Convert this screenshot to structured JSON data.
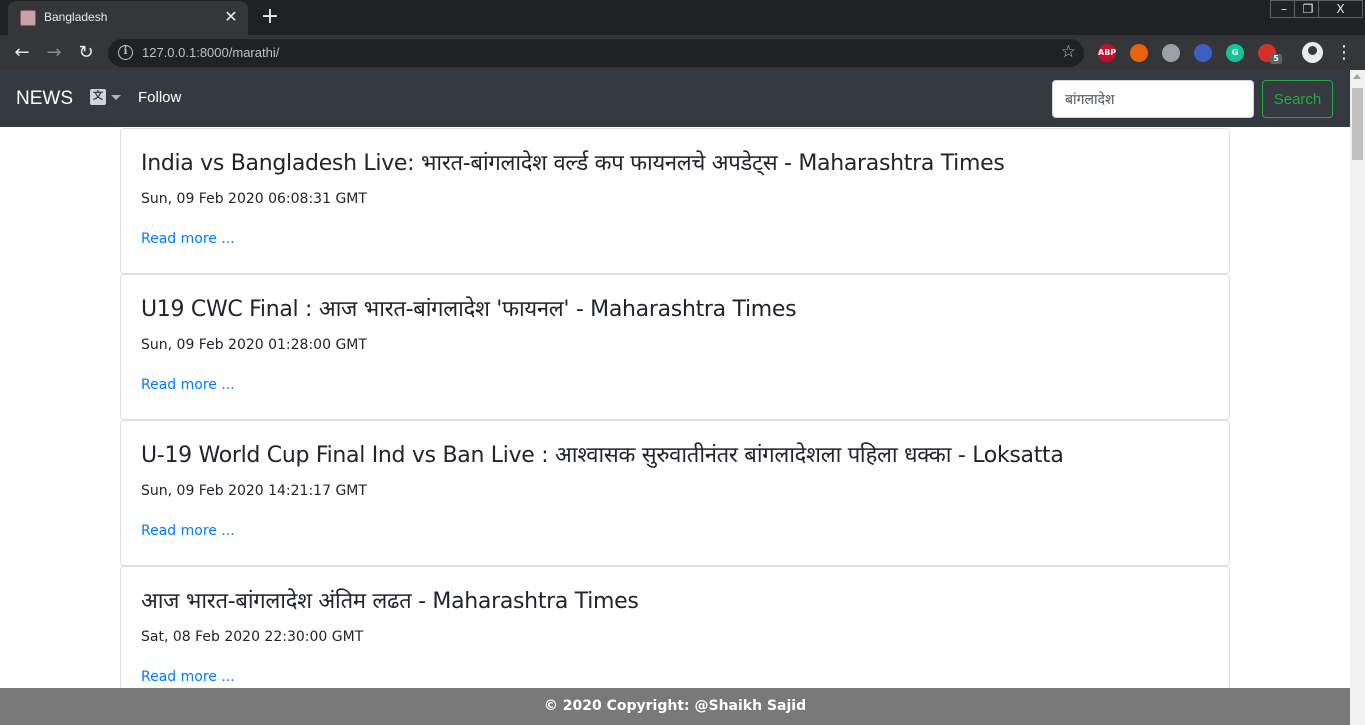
{
  "browser": {
    "tab_title": "Bangladesh",
    "tab_close": "✕",
    "new_tab": "+",
    "url": "127.0.0.1:8000/marathi/",
    "window_controls": {
      "minimize": "–",
      "restore": "❐",
      "close": "X"
    },
    "extensions": [
      {
        "name": "adblock-plus-icon",
        "label": "ABP",
        "color": "#c70d2c"
      },
      {
        "name": "honey-icon",
        "label": "",
        "color": "#e8620f"
      },
      {
        "name": "camera-icon",
        "label": "",
        "color": "#9aa0a6"
      },
      {
        "name": "screen-icon",
        "label": "",
        "color": "#3c5fc4"
      },
      {
        "name": "grammarly-icon",
        "label": "G",
        "color": "#15c39a"
      },
      {
        "name": "mail-icon",
        "label": "",
        "color": "#d93025",
        "badge": "5"
      }
    ]
  },
  "navbar": {
    "brand": "NEWS",
    "follow": "Follow",
    "search_value": "बांगलादेश",
    "search_button": "Search"
  },
  "articles": [
    {
      "title": "India vs Bangladesh Live: भारत-बांगलादेश वर्ल्ड कप फायनलचे अपडेट्स - Maharashtra Times",
      "date": "Sun, 09 Feb 2020 06:08:31 GMT",
      "link_label": "Read more ..."
    },
    {
      "title": "U19 CWC Final : आज भारत-बांगलादेश 'फायनल' - Maharashtra Times",
      "date": "Sun, 09 Feb 2020 01:28:00 GMT",
      "link_label": "Read more ..."
    },
    {
      "title": "U-19 World Cup Final Ind vs Ban Live : आश्वासक सुरुवातीनंतर बांगलादेशला पहिला धक्का - Loksatta",
      "date": "Sun, 09 Feb 2020 14:21:17 GMT",
      "link_label": "Read more ..."
    },
    {
      "title": "आज भारत-बांगलादेश अंतिम लढत - Maharashtra Times",
      "date": "Sat, 08 Feb 2020 22:30:00 GMT",
      "link_label": "Read more ..."
    }
  ],
  "footer": {
    "text": "© 2020 Copyright: @Shaikh Sajid"
  }
}
